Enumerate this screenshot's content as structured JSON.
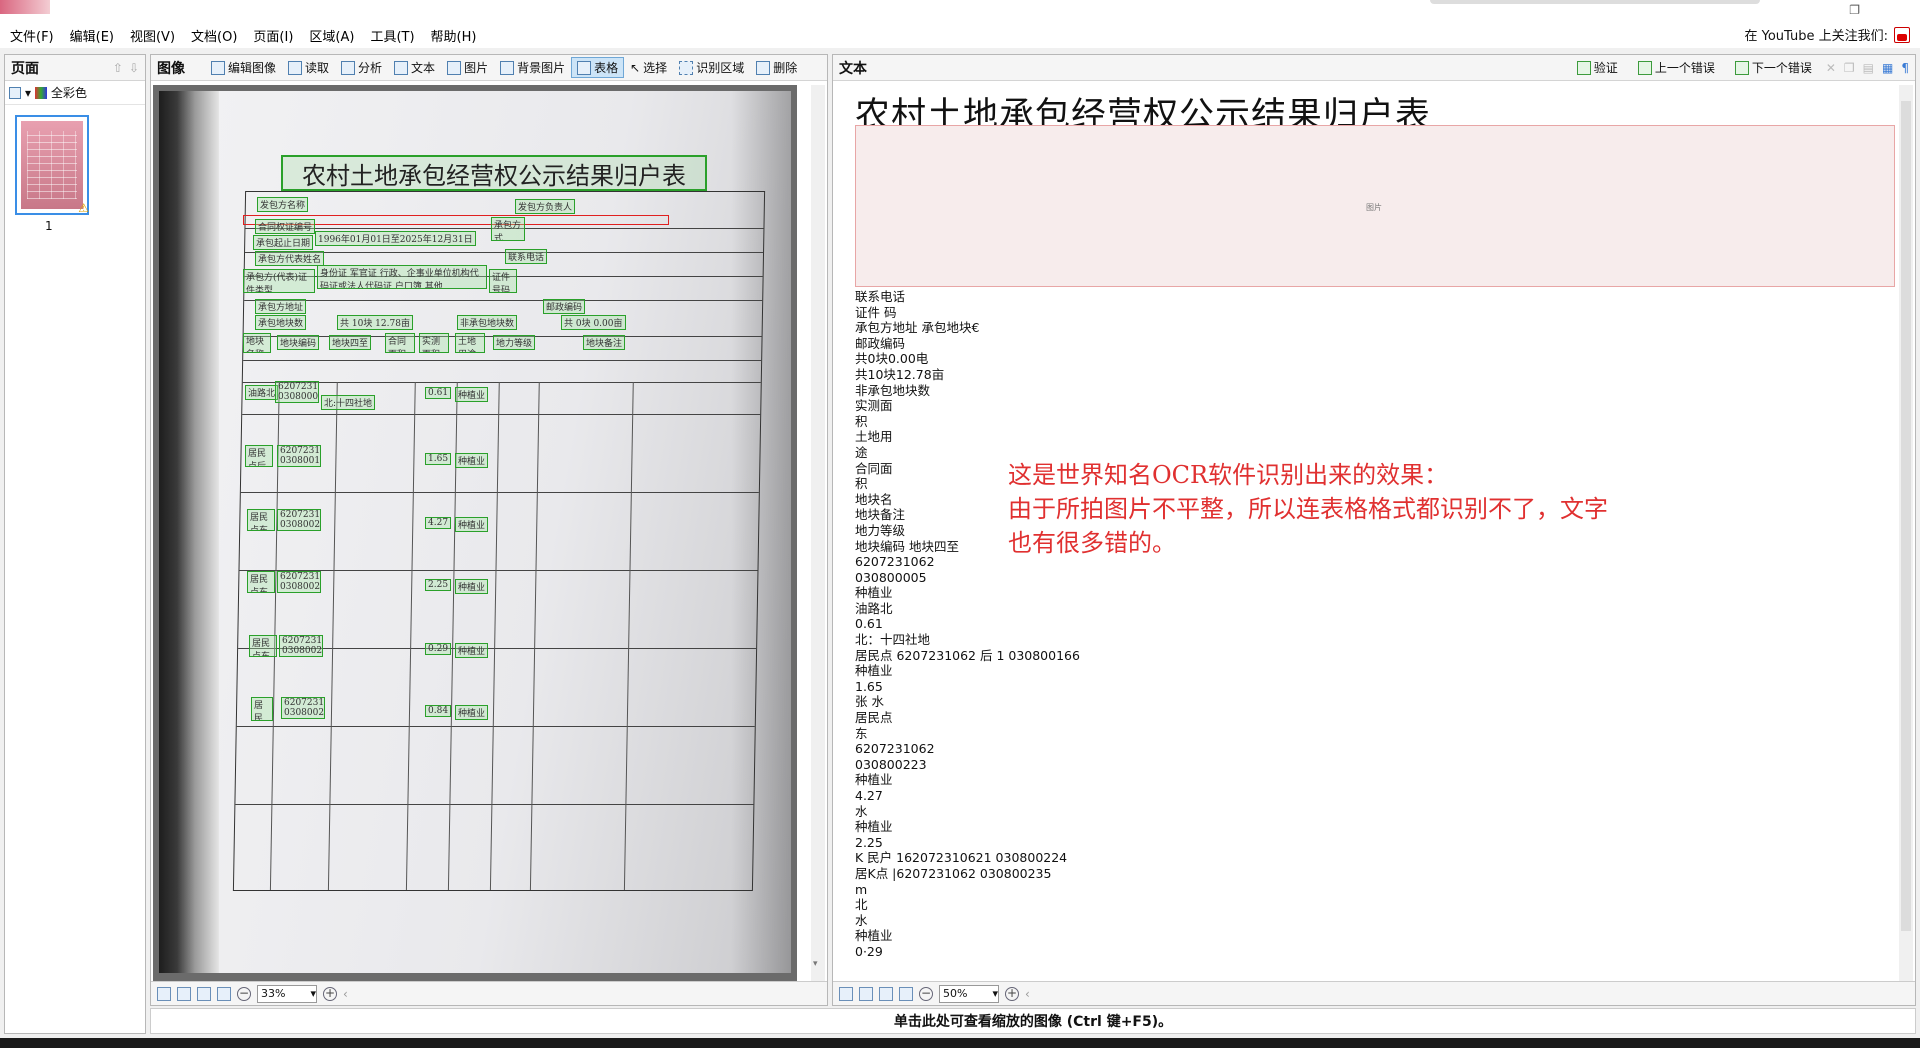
{
  "menu": [
    "文件(F)",
    "编辑(E)",
    "视图(V)",
    "文档(O)",
    "页面(I)",
    "区域(A)",
    "工具(T)",
    "帮助(H)"
  ],
  "youtube_label": "在 YouTube 上关注我们:",
  "pages_panel": {
    "title": "页面",
    "color_mode": "全彩色",
    "page_number": "1"
  },
  "image_panel": {
    "title": "图像",
    "tools": [
      "编辑图像",
      "读取",
      "分析",
      "文本",
      "图片",
      "背景图片",
      "表格",
      "选择",
      "识别区域",
      "删除"
    ],
    "active_tool": "表格",
    "zoom": "33%",
    "doc_title": "农村土地承包经营权公示结果归户表",
    "field_labels": [
      "发包方名称",
      "发包方负责人",
      "合同权证编号",
      "承包起止日期",
      "1996年01月01日至2025年12月31日",
      "承包方式",
      "承包方代表姓名",
      "联系电话",
      "承包方(代表)证件类型",
      "身份证  军官证  行政、企事业单位机构代码证或法人代码证  户口簿  其他",
      "证件号码",
      "承包方地址",
      "邮政编码",
      "承包地块数",
      "共 10块 12.78亩",
      "非承包地块数",
      "共 0块 0.00亩",
      "地块名称",
      "地块编码",
      "地块四至",
      "合同面积",
      "实测面积",
      "土地用途",
      "地力等级",
      "地块备注",
      "油路北",
      "6207231062 030800005",
      "北:十四社地",
      "0.61",
      "种植业",
      "居民点后",
      "6207231062 030800166",
      "1.65",
      "种植业",
      "居民点东",
      "6207231062 030800223",
      "4.27",
      "种植业",
      "居民点东",
      "6207231062 030800224",
      "2.25",
      "种植业",
      "居民点东",
      "6207231062 030800235",
      "0.29",
      "种植业",
      "居民点",
      "6207231062 030800243",
      "0.84",
      "种植业"
    ]
  },
  "text_panel": {
    "title": "文本",
    "tools": [
      "验证",
      "上一个错误",
      "下一个错误"
    ],
    "zoom": "50%",
    "main_title": "农村土地承包经营权公示结果归户表",
    "picture_label": "图片",
    "lines": [
      "联系电话",
      "证件   码",
      "承包方地址  承包地块€",
      "邮政编码",
      "共0块0.00电",
      "共10块12.78亩",
      "非承包地块数",
      "实测面",
      "积",
      "土地用",
      "途",
      "合同面",
      "积",
      "地块名",
      "地块备注",
      "地力等级",
      "地块编码        地块四至",
      "6207231062",
      "030800005",
      "种植业",
      "油路北",
      "0.61",
      "北：十四社地",
      "居民点 6207231062 后 1 030800166",
      "种植业",
      "1.65",
      "张 水",
      "居民点",
      "东",
      "6207231062",
      "030800223",
      "种植业",
      "4.27",
      "水",
      "种植业",
      "2.25",
      "K 民户 162072310621 030800224",
      "居K点 |6207231062 030800235",
      "m",
      "北",
      "水",
      "种植业",
      "0·29"
    ],
    "annotation": [
      "这是世界知名OCR软件识别出来的效果：",
      "由于所拍图片不平整，所以连表格格式都识别不了，文字",
      "也有很多错的。"
    ]
  },
  "status_text": "单击此处可查看缩放的图像 (Ctrl 键+F5)。",
  "colors": {
    "accent": "#3a8ee6",
    "region_green": "#2aa02a",
    "annotation_red": "#e03030"
  }
}
